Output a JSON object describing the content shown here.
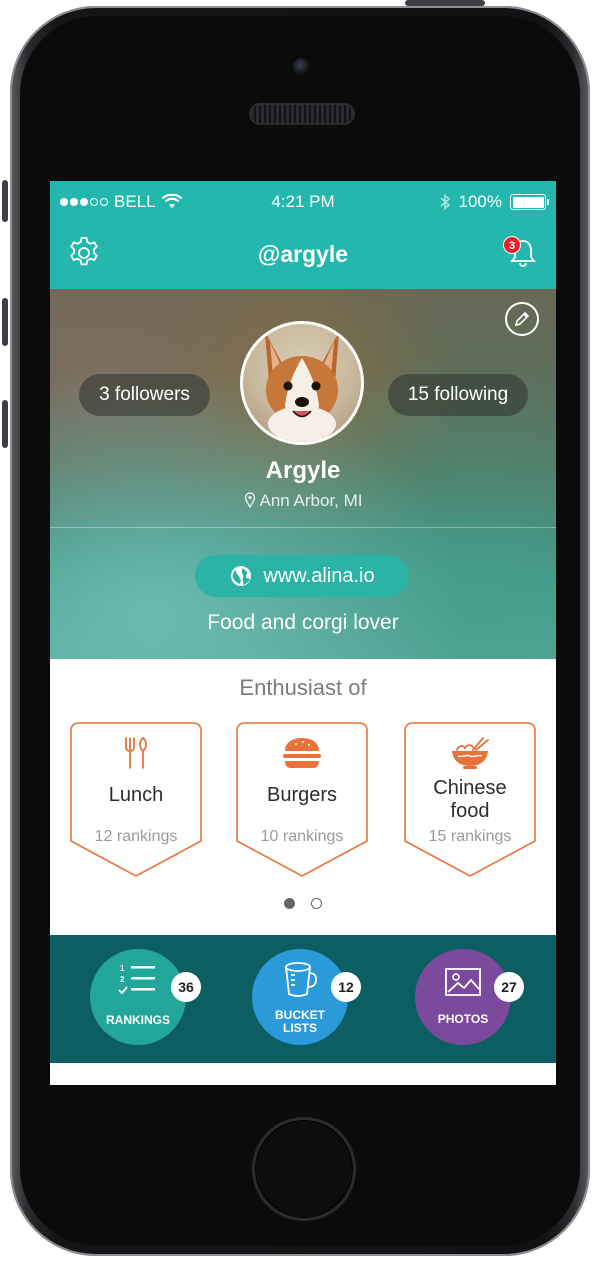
{
  "status_bar": {
    "carrier": "BELL",
    "time": "4:21 PM",
    "battery": "100%"
  },
  "nav": {
    "title": "@argyle",
    "notification_count": "3"
  },
  "profile": {
    "followers": "3 followers",
    "following": "15 following",
    "name": "Argyle",
    "location": "Ann Arbor, MI",
    "website": "www.alina.io",
    "bio": "Food and corgi lover"
  },
  "enthusiast": {
    "title": "Enthusiast of",
    "cards": [
      {
        "label": "Lunch",
        "count": "12 rankings",
        "icon": "utensils-icon"
      },
      {
        "label": "Burgers",
        "count": "10 rankings",
        "icon": "burger-icon"
      },
      {
        "label_line1": "Chinese",
        "label_line2": "food",
        "count": "15 rankings",
        "icon": "noodle-bowl-icon"
      }
    ],
    "page_count": 2,
    "current_page": 1
  },
  "stats": {
    "rankings": {
      "label": "RANKINGS",
      "count": "36",
      "color": "#23a69a"
    },
    "bucket_lists": {
      "label_line1": "BUCKET",
      "label_line2": "LISTS",
      "count": "12",
      "color": "#2a9bd8"
    },
    "photos": {
      "label": "PHOTOS",
      "count": "27",
      "color": "#7c4a9c"
    }
  },
  "colors": {
    "teal": "#23b7ad",
    "orange": "#e8733a",
    "dark_teal": "#0d5e63"
  }
}
